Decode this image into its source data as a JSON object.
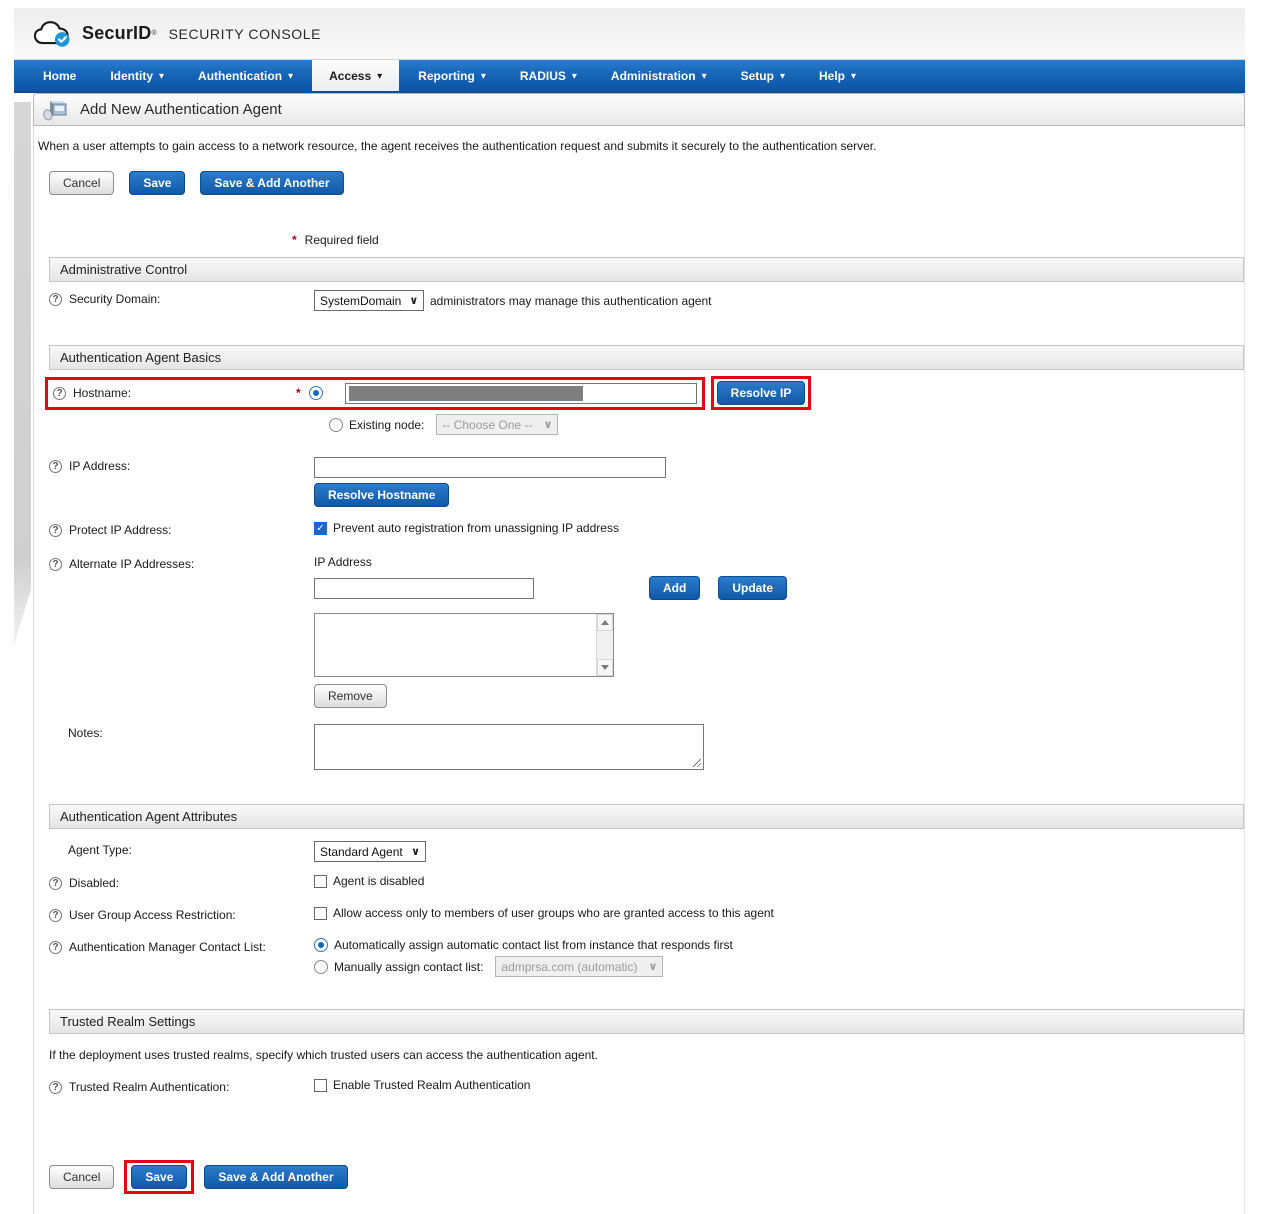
{
  "colors": {
    "nav_blue": "#1766b8",
    "button_blue": "#1565b5",
    "annotation_red": "#e30613",
    "checkbox_blue": "#1868c9"
  },
  "icons": {
    "nav_caret": "▾",
    "select_chevron": "∨",
    "help": "?",
    "check": "✓"
  },
  "header": {
    "brand": "SecurID",
    "trademark": "®",
    "product": "SECURITY CONSOLE"
  },
  "nav": {
    "items": [
      {
        "label": "Home"
      },
      {
        "label": "Identity"
      },
      {
        "label": "Authentication"
      },
      {
        "label": "Access"
      },
      {
        "label": "Reporting"
      },
      {
        "label": "RADIUS"
      },
      {
        "label": "Administration"
      },
      {
        "label": "Setup"
      },
      {
        "label": "Help"
      }
    ]
  },
  "page": {
    "title": "Add New Authentication Agent",
    "intro": "When a user attempts to gain access to a network resource, the agent receives the authentication request and submits it securely to the authentication server.",
    "required_marker": "*",
    "required_note": "Required field"
  },
  "buttons": {
    "cancel": "Cancel",
    "save": "Save",
    "save_add_another": "Save & Add Another",
    "resolve_ip": "Resolve IP",
    "resolve_hostname": "Resolve Hostname",
    "add": "Add",
    "update": "Update",
    "remove": "Remove"
  },
  "admin_control": {
    "title": "Administrative Control",
    "security_domain_label": "Security Domain:",
    "security_domain_value": "SystemDomain",
    "security_domain_suffix": "administrators may manage this authentication agent"
  },
  "agent_basics": {
    "title": "Authentication Agent Basics",
    "hostname_label": "Hostname:",
    "existing_node_label": "Existing node:",
    "existing_node_value": "-- Choose One --",
    "ip_address_label": "IP Address:",
    "protect_ip_label": "Protect IP Address:",
    "protect_ip_option": "Prevent auto registration from unassigning IP address",
    "alternate_ip_label": "Alternate IP Addresses:",
    "alternate_ip_column": "IP Address",
    "notes_label": "Notes:"
  },
  "agent_attributes": {
    "title": "Authentication Agent Attributes",
    "agent_type_label": "Agent Type:",
    "agent_type_value": "Standard Agent",
    "disabled_label": "Disabled:",
    "disabled_option": "Agent is disabled",
    "user_group_label": "User Group Access Restriction:",
    "user_group_option": "Allow access only to members of user groups who are granted access to this agent",
    "contact_list_label": "Authentication Manager Contact List:",
    "contact_list_auto": "Automatically assign automatic contact list from instance that responds first",
    "contact_list_manual": "Manually assign contact list:",
    "contact_list_manual_value": "admprsa.com (automatic)"
  },
  "trusted_realm": {
    "title": "Trusted Realm Settings",
    "description": "If the deployment uses trusted realms, specify which trusted users can access the authentication agent.",
    "tra_label": "Trusted Realm Authentication:",
    "tra_option": "Enable Trusted Realm Authentication"
  }
}
